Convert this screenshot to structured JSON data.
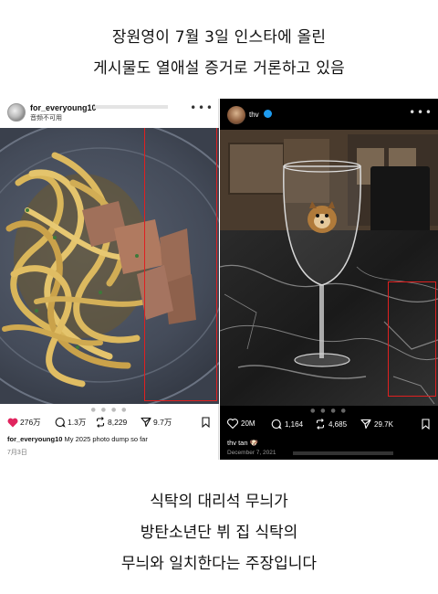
{
  "headline": {
    "line1": "장원영이 7월 3일 인스타에 올린",
    "line2": "게시물도 열애설 증거로 거론하고 있음"
  },
  "left_post": {
    "username": "for_everyoung10",
    "music_label": "音频不可用",
    "likes": "276万",
    "comments": "1.3万",
    "reposts": "8,229",
    "shares": "9.7万",
    "caption_user": "for_everyoung10",
    "caption_text": " My 2025 photo dump so far",
    "date": "7月3日",
    "heart_color": "#e0245e"
  },
  "right_post": {
    "username": "thv",
    "likes": "20M",
    "comments": "1,164",
    "reposts": "4,685",
    "shares": "29.7K",
    "caption": "thv tan 🐶",
    "date": "December 7, 2021"
  },
  "caption": {
    "line1": "식탁의 대리석 무늬가",
    "line2": "방탄소년단 뷔 집 식탁의",
    "line3": "무늬와 일치한다는 주장입니다"
  },
  "colors": {
    "highlight": "#e02020",
    "verified": "#1d9bf0"
  }
}
